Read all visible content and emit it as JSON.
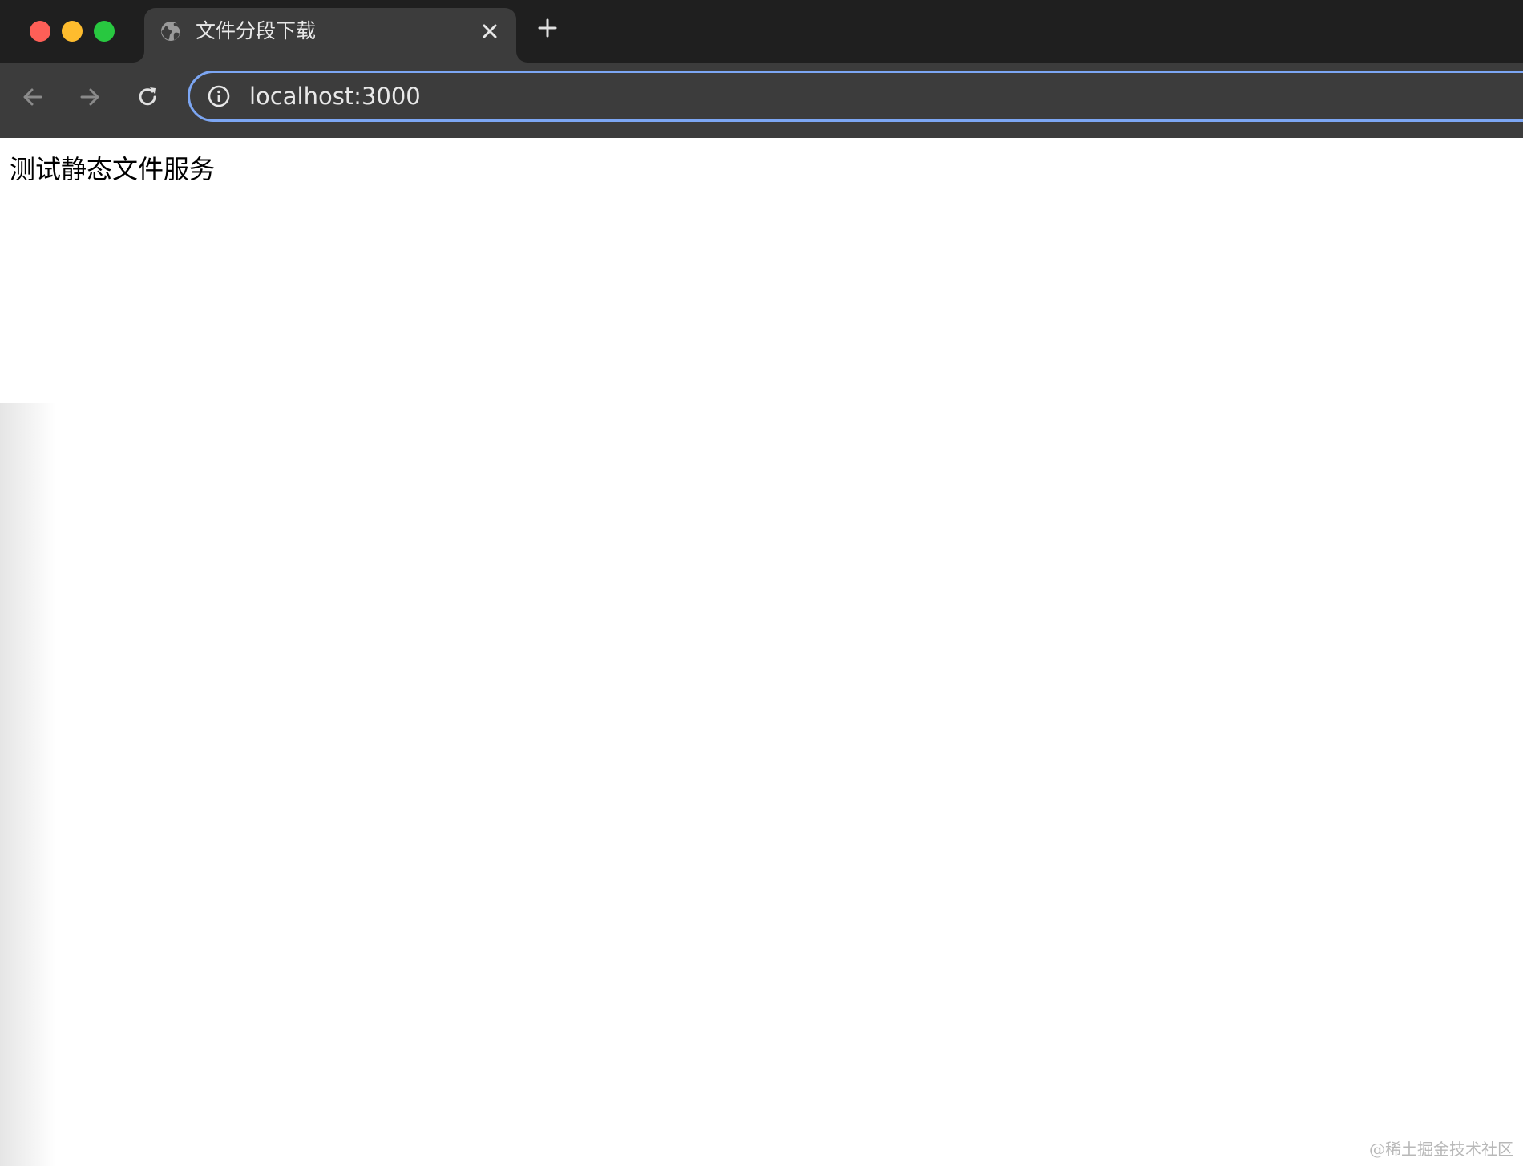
{
  "tab": {
    "title": "文件分段下载",
    "favicon": "globe-icon",
    "close_icon": "close-icon"
  },
  "tabstrip": {
    "new_tab_icon": "plus-icon"
  },
  "window_controls": [
    "close",
    "minimize",
    "maximize"
  ],
  "toolbar": {
    "back_icon": "arrow-left-icon",
    "forward_icon": "arrow-right-icon",
    "reload_icon": "reload-icon",
    "address_info_icon": "info-icon",
    "address": "localhost:3000"
  },
  "page": {
    "text": "测试静态文件服务"
  },
  "watermark": "@稀土掘金技术社区",
  "colors": {
    "tabstrip_bg": "#1f1f1f",
    "toolbar_bg": "#3c3c3c",
    "omnibox_focus": "#7ca6f3",
    "close_light": "#fe5f57",
    "minimize_light": "#febc2e",
    "maximize_light": "#28c840"
  }
}
